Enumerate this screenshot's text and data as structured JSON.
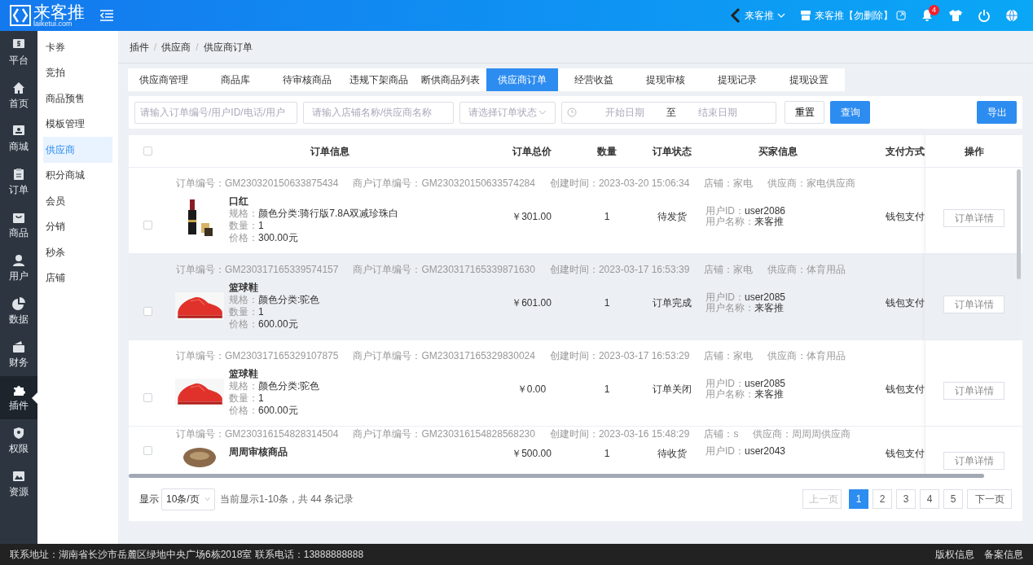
{
  "header": {
    "logo_text": "来客推",
    "logo_sub": "laiketui.com",
    "store_switch": "来客推",
    "shop_name": "来客推【勿删除】",
    "notification_count": "4"
  },
  "rail": [
    {
      "label": "平台",
      "selected": false
    },
    {
      "label": "首页",
      "selected": false
    },
    {
      "label": "商城",
      "selected": false
    },
    {
      "label": "订单",
      "selected": false
    },
    {
      "label": "商品",
      "selected": false
    },
    {
      "label": "用户",
      "selected": false
    },
    {
      "label": "数据",
      "selected": false
    },
    {
      "label": "财务",
      "selected": false
    },
    {
      "label": "插件",
      "selected": true
    },
    {
      "label": "权限",
      "selected": false
    },
    {
      "label": "资源",
      "selected": false
    }
  ],
  "submenu": [
    {
      "label": "卡券",
      "selected": false
    },
    {
      "label": "竞拍",
      "selected": false
    },
    {
      "label": "商品预售",
      "selected": false
    },
    {
      "label": "模板管理",
      "selected": false
    },
    {
      "label": "供应商",
      "selected": true
    },
    {
      "label": "积分商城",
      "selected": false
    },
    {
      "label": "会员",
      "selected": false
    },
    {
      "label": "分销",
      "selected": false
    },
    {
      "label": "秒杀",
      "selected": false
    },
    {
      "label": "店铺",
      "selected": false
    }
  ],
  "breadcrumb": {
    "items": [
      "插件",
      "供应商",
      "供应商订单"
    ],
    "separator": "/"
  },
  "tabs": [
    {
      "label": "供应商管理",
      "selected": false
    },
    {
      "label": "商品库",
      "selected": false
    },
    {
      "label": "待审核商品",
      "selected": false
    },
    {
      "label": "违规下架商品",
      "selected": false
    },
    {
      "label": "断供商品列表",
      "selected": false
    },
    {
      "label": "供应商订单",
      "selected": true
    },
    {
      "label": "经营收益",
      "selected": false
    },
    {
      "label": "提现审核",
      "selected": false
    },
    {
      "label": "提现记录",
      "selected": false
    },
    {
      "label": "提现设置",
      "selected": false
    }
  ],
  "filters": {
    "order_search": {
      "placeholder": "请输入订单编号/用户ID/电话/用户"
    },
    "store_search": {
      "placeholder": "请输入店铺名称/供应商名称"
    },
    "status_select": {
      "placeholder": "请选择订单状态"
    },
    "start_date": {
      "placeholder": "开始日期"
    },
    "range_separator": "至",
    "end_date": {
      "placeholder": "结束日期"
    },
    "reset": "重置",
    "query": "查询",
    "export": "导出"
  },
  "table": {
    "select_all": {
      "checked": false
    },
    "columns": [
      "订单信息",
      "订单总价",
      "数量",
      "订单状态",
      "买家信息",
      "支付方式",
      "操作"
    ],
    "rows": [
      {
        "checked": false,
        "highlighted": false,
        "order_no": "订单编号：GM230320150633875434",
        "merchant_order_no": "商户订单编号：GM230320150633574284",
        "created": "创建时间：2023-03-20 15:06:34",
        "store": "店铺：家电",
        "supplier": "供应商：家电供应商",
        "product": "口红",
        "spec_label": "规格：",
        "spec": "颜色分类:骑行版7.8A双减珍珠白",
        "qty_label": "数量：",
        "qty": "1",
        "price_label": "价格：",
        "price": "300.00元",
        "total": "￥301.00",
        "quantity": "1",
        "status": "待发货",
        "user_id_label": "用户ID：",
        "user_id": "user2086",
        "user_name_label": "用户名称：",
        "user_name": "来客推",
        "payment": "钱包支付",
        "action": "订单详情"
      },
      {
        "checked": false,
        "highlighted": true,
        "order_no": "订单编号：GM230317165339574157",
        "merchant_order_no": "商户订单编号：GM230317165339871630",
        "created": "创建时间：2023-03-17 16:53:39",
        "store": "店铺：家电",
        "supplier": "供应商：体育用品",
        "product": "篮球鞋",
        "spec_label": "规格：",
        "spec": "颜色分类:驼色",
        "qty_label": "数量：",
        "qty": "1",
        "price_label": "价格：",
        "price": "600.00元",
        "total": "￥601.00",
        "quantity": "1",
        "status": "订单完成",
        "user_id_label": "用户ID：",
        "user_id": "user2085",
        "user_name_label": "用户名称：",
        "user_name": "来客推",
        "payment": "钱包支付",
        "action": "订单详情"
      },
      {
        "checked": false,
        "highlighted": false,
        "order_no": "订单编号：GM230317165329107875",
        "merchant_order_no": "商户订单编号：GM230317165329830024",
        "created": "创建时间：2023-03-17 16:53:29",
        "store": "店铺：家电",
        "supplier": "供应商：体育用品",
        "product": "篮球鞋",
        "spec_label": "规格：",
        "spec": "颜色分类:驼色",
        "qty_label": "数量：",
        "qty": "1",
        "price_label": "价格：",
        "price": "600.00元",
        "total": "￥0.00",
        "quantity": "1",
        "status": "订单关闭",
        "user_id_label": "用户ID：",
        "user_id": "user2085",
        "user_name_label": "用户名称：",
        "user_name": "来客推",
        "payment": "钱包支付",
        "action": "订单详情"
      },
      {
        "checked": false,
        "highlighted": false,
        "order_no": "订单编号：GM230316154828314504",
        "merchant_order_no": "商户订单编号：GM230316154828568230",
        "created": "创建时间：2023-03-16 15:48:29",
        "store": "店铺：s",
        "supplier": "供应商：周周周供应商",
        "product": "周周审核商品",
        "total": "￥500.00",
        "quantity": "1",
        "status": "待收货",
        "user_id_label": "用户ID：",
        "user_id": "user2043",
        "payment": "钱包支付",
        "action": "订单详情"
      }
    ]
  },
  "pagination": {
    "show_label": "显示",
    "page_size": "10条/页",
    "summary": "当前显示1-10条，共 44 条记录",
    "prev": {
      "label": "上一页",
      "disabled": true
    },
    "pages": [
      {
        "label": "1",
        "selected": true
      },
      {
        "label": "2",
        "selected": false
      },
      {
        "label": "3",
        "selected": false
      },
      {
        "label": "4",
        "selected": false
      },
      {
        "label": "5",
        "selected": false
      }
    ],
    "next": {
      "label": "下一页",
      "disabled": false
    }
  },
  "footer": {
    "contact": "联系地址：湖南省长沙市岳麓区绿地中央广场6栋2018室 联系电话：13888888888",
    "links": [
      "版权信息",
      "备案信息"
    ]
  }
}
